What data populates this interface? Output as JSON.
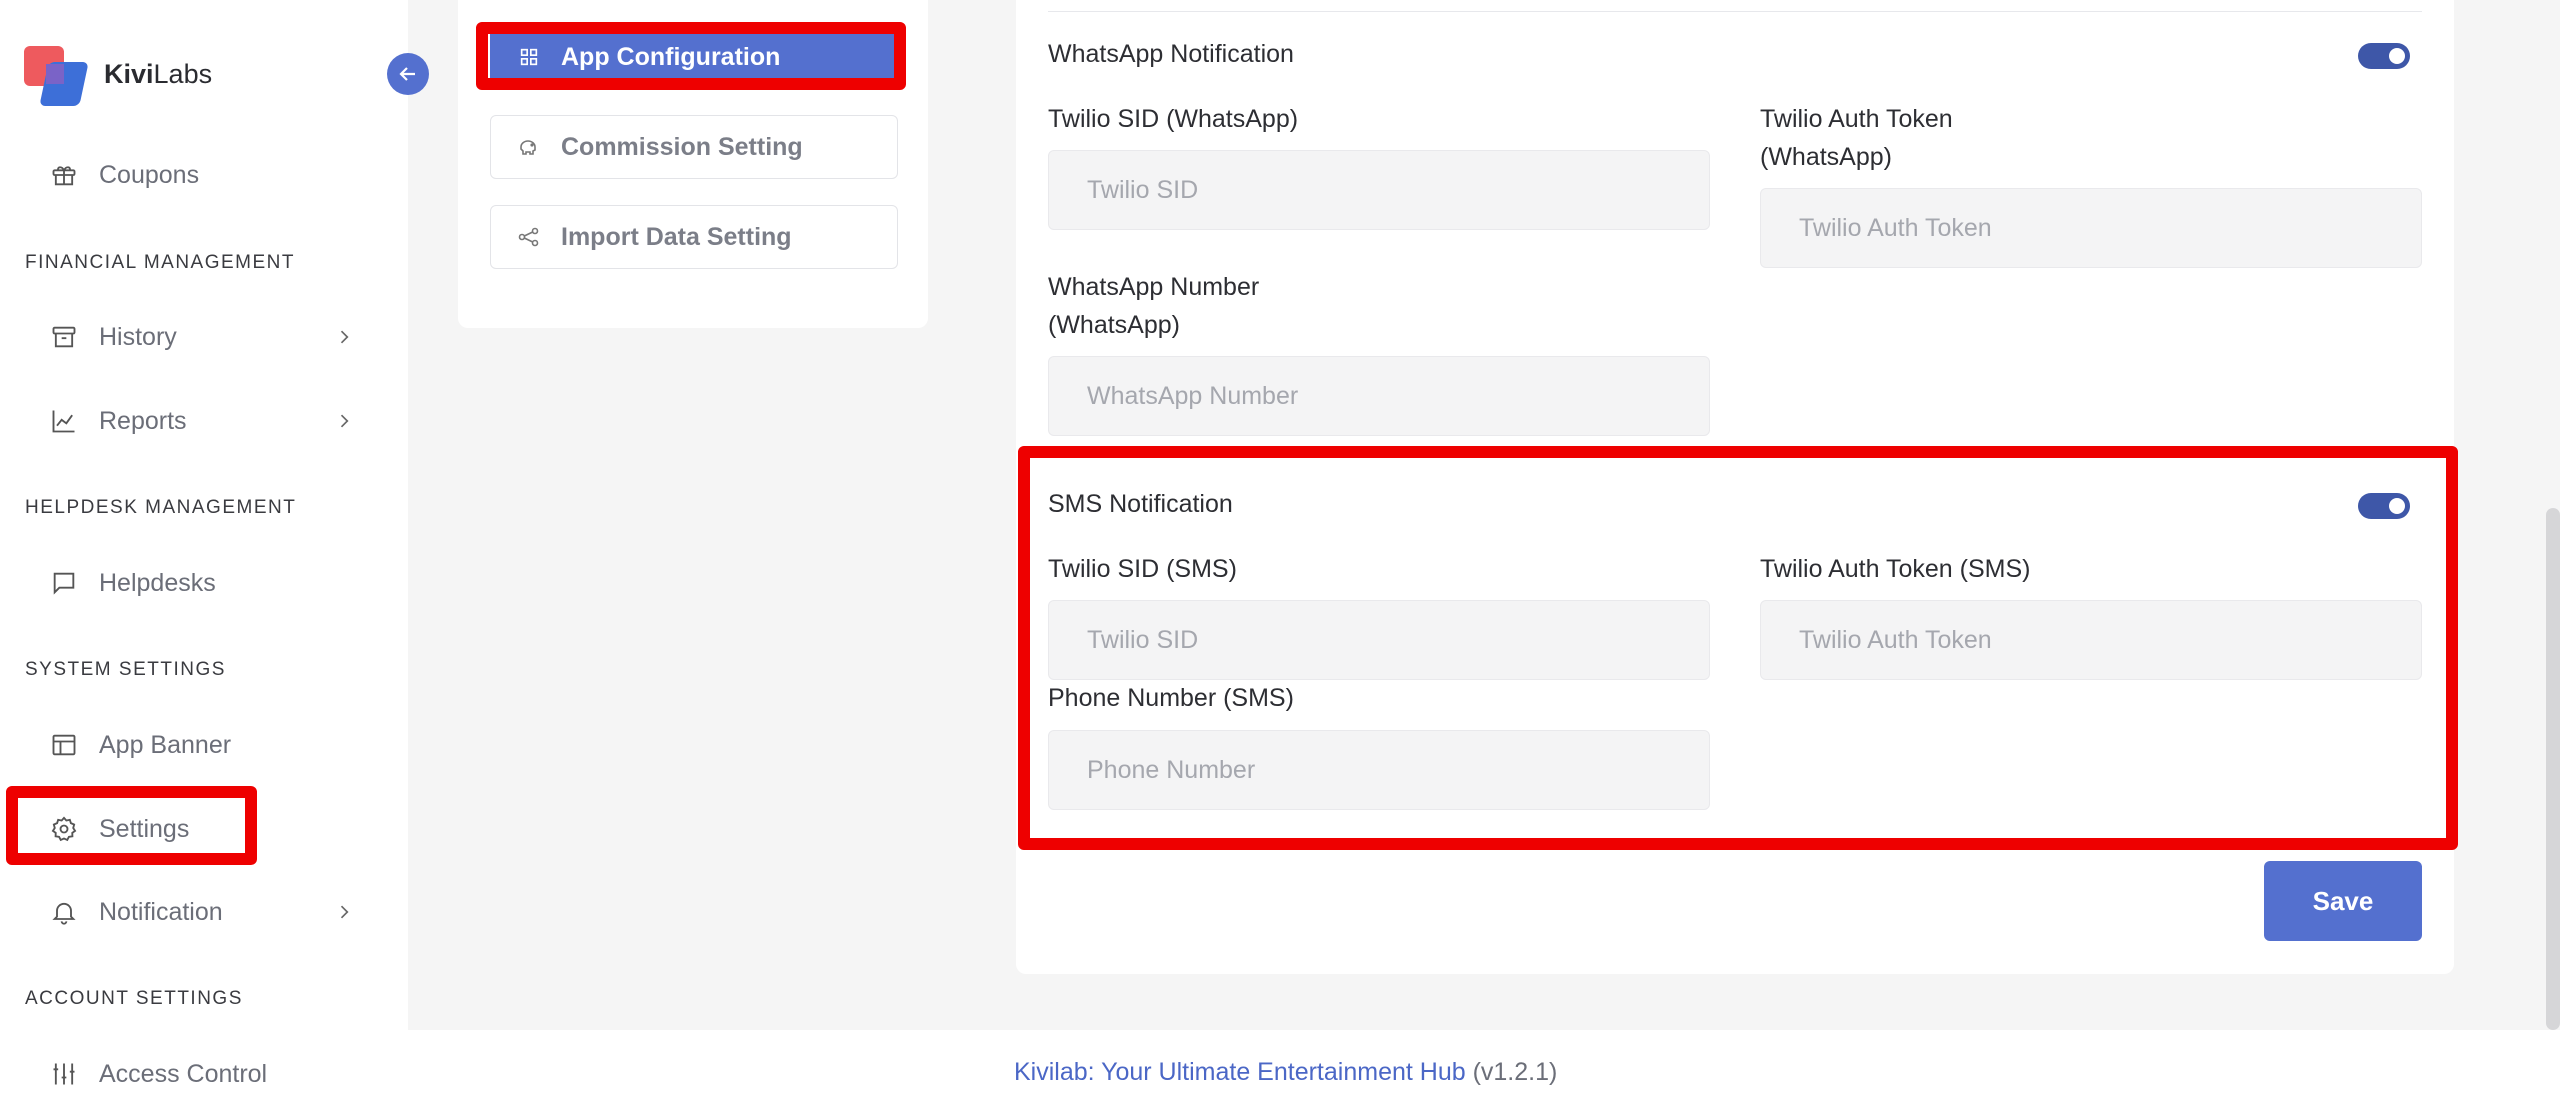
{
  "brand": {
    "name_bold": "Kivi",
    "name_rest": "Labs"
  },
  "sidebar": {
    "items": {
      "coupons": "Coupons",
      "history": "History",
      "reports": "Reports",
      "helpdesks": "Helpdesks",
      "app_banner": "App Banner",
      "settings": "Settings",
      "notification": "Notification",
      "access_control": "Access Control"
    },
    "sections": {
      "financial": "FINANCIAL MANAGEMENT",
      "helpdesk": "HELPDESK MANAGEMENT",
      "system": "SYSTEM SETTINGS",
      "account": "ACCOUNT SETTINGS"
    }
  },
  "settings_menu": {
    "app_configuration": "App Configuration",
    "commission_setting": "Commission Setting",
    "import_data_setting": "Import Data Setting"
  },
  "whatsapp": {
    "title": "WhatsApp Notification",
    "enabled": true,
    "sid_label": "Twilio SID (WhatsApp)",
    "sid_placeholder": "Twilio SID",
    "token_label": "Twilio Auth Token (WhatsApp)",
    "token_placeholder": "Twilio Auth Token",
    "number_label": "WhatsApp Number (WhatsApp)",
    "number_placeholder": "WhatsApp Number"
  },
  "sms": {
    "title": "SMS Notification",
    "enabled": true,
    "sid_label": "Twilio SID (SMS)",
    "sid_placeholder": "Twilio SID",
    "token_label": "Twilio Auth Token (SMS)",
    "token_placeholder": "Twilio Auth Token",
    "phone_label": "Phone Number (SMS)",
    "phone_placeholder": "Phone Number"
  },
  "actions": {
    "save": "Save"
  },
  "footer": {
    "brand_text": "Kivilab: Your Ultimate Entertainment Hub",
    "version": " (v1.2.1)"
  },
  "colors": {
    "accent": "#5470cf",
    "highlight": "#ee0000",
    "toggle": "#3e57a8"
  }
}
